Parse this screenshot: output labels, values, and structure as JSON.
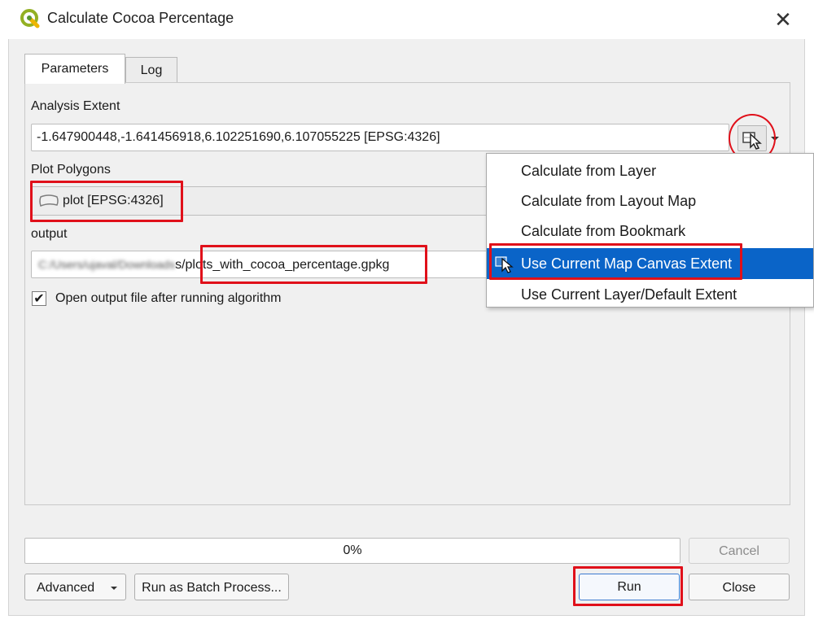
{
  "window": {
    "title": "Calculate Cocoa Percentage",
    "close_glyph": "✕"
  },
  "tabs": [
    {
      "label": "Parameters",
      "active": true
    },
    {
      "label": "Log",
      "active": false
    }
  ],
  "params": {
    "analysis_extent": {
      "label": "Analysis Extent",
      "value": "-1.647900448,-1.641456918,6.102251690,6.107055225 [EPSG:4326]"
    },
    "plot_polygons": {
      "label": "Plot Polygons",
      "value": "plot [EPSG:4326]"
    },
    "output": {
      "label": "output",
      "blurred_prefix": "C:/Users/ujaval/Downloads",
      "visible_prefix": "s",
      "value": "/plots_with_cocoa_percentage.gpkg"
    },
    "open_output": {
      "label": "Open output file after running algorithm",
      "checked": true,
      "check_glyph": "✔"
    }
  },
  "extent_menu": {
    "items": [
      {
        "label": "Calculate from Layer",
        "selected": false
      },
      {
        "label": "Calculate from Layout Map",
        "selected": false
      },
      {
        "label": "Calculate from Bookmark",
        "selected": false
      },
      {
        "label": "Use Current Map Canvas Extent",
        "selected": true
      },
      {
        "label": "Use Current Layer/Default Extent",
        "selected": false
      }
    ]
  },
  "progress": {
    "text": "0%",
    "value": 0
  },
  "buttons": {
    "cancel": "Cancel",
    "advanced": "Advanced",
    "batch": "Run as Batch Process...",
    "run": "Run",
    "close": "Close"
  },
  "icons": {
    "logo": "qgis-logo-icon",
    "extent": "map-canvas-cursor-icon",
    "polygon": "polygon-layer-icon",
    "dropdown": "chevron-down-icon"
  },
  "colors": {
    "highlight": "#e0101a",
    "selection": "#0a64c8"
  }
}
